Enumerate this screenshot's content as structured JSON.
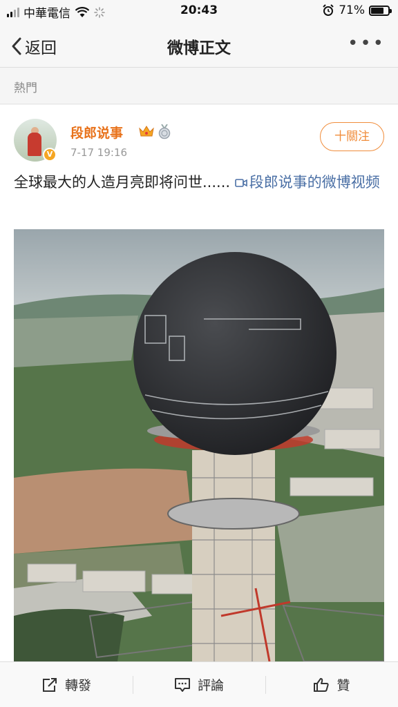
{
  "status_bar": {
    "carrier": "中華電信",
    "time": "20:43",
    "battery": "71%",
    "battery_level": 0.71
  },
  "nav": {
    "back_label": "返回",
    "title": "微博正文",
    "more": "•••"
  },
  "section": {
    "label": "熱門"
  },
  "post": {
    "author": "段郎说事",
    "avatar_badge": "V",
    "time": "7-17 19:16",
    "follow_label": "十關注",
    "text": "全球最大的人造月亮即将问世......",
    "video_link": "段郎说事的微博视频",
    "media_icon": "video-icon"
  },
  "actions": {
    "repost": {
      "label": "轉發",
      "icon": "share-icon"
    },
    "comment": {
      "label": "評論",
      "icon": "comment-icon"
    },
    "like": {
      "label": "贊",
      "icon": "thumbs-up-icon"
    }
  },
  "colors": {
    "accent": "#f08c3a",
    "username": "#e8721b",
    "link": "#4a6fa5"
  }
}
